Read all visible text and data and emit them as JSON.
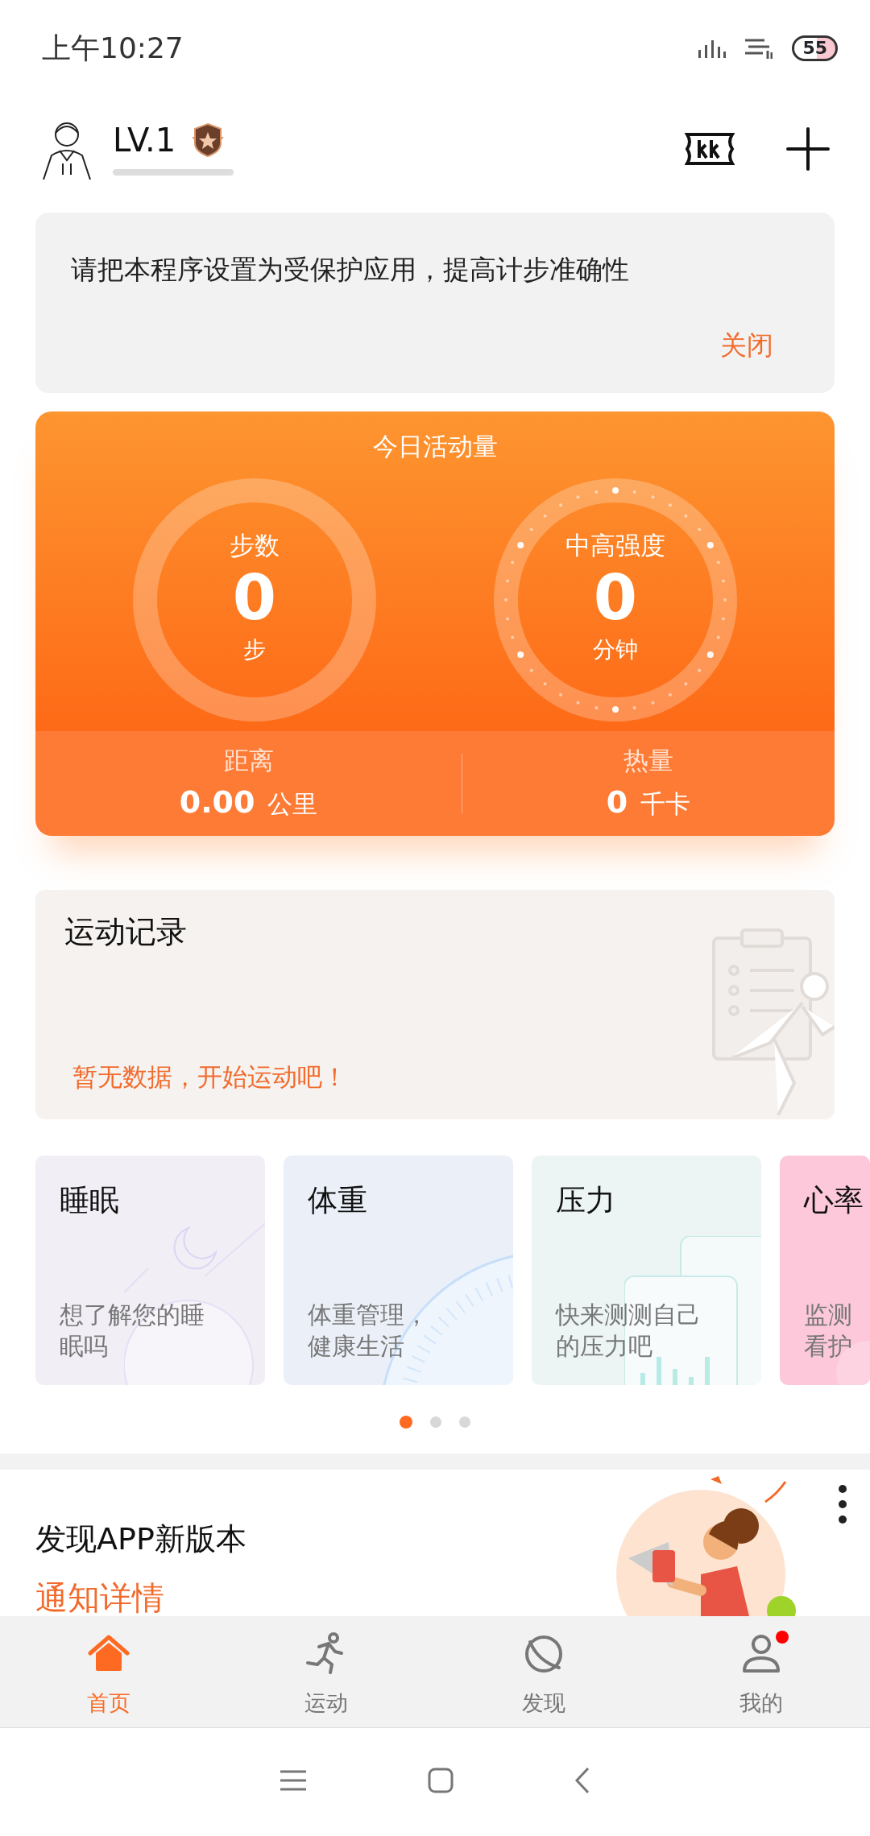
{
  "status_bar": {
    "time": "上午10:27",
    "battery": "55"
  },
  "header": {
    "level_label": "LV.1"
  },
  "notice": {
    "text": "请把本程序设置为受保护应用，提高计步准确性",
    "action": "关闭"
  },
  "activity": {
    "title": "今日活动量",
    "rings": [
      {
        "kind": "plain",
        "label": "步数",
        "value": "0",
        "unit": "步"
      },
      {
        "kind": "dotted",
        "label": "中高强度",
        "value": "0",
        "unit": "分钟"
      }
    ],
    "stats": [
      {
        "label": "距离",
        "value": "0.00",
        "unit": "公里"
      },
      {
        "label": "热量",
        "value": "0",
        "unit": "千卡"
      }
    ]
  },
  "records": {
    "title": "运动记录",
    "empty_text": "暂无数据，开始运动吧！"
  },
  "health_cards": [
    {
      "kind": "sleep",
      "title": "睡眠",
      "desc_lines": [
        "想了解您的睡",
        "眠吗"
      ]
    },
    {
      "kind": "weight",
      "title": "体重",
      "desc_lines": [
        "体重管理，",
        "健康生活"
      ]
    },
    {
      "kind": "stress",
      "title": "压力",
      "desc_lines": [
        "快来测测自己",
        "的压力吧"
      ]
    },
    {
      "kind": "heart",
      "title": "心率",
      "desc_lines": [
        "监测",
        "看护"
      ]
    }
  ],
  "page_dots": [
    {
      "selected": true
    },
    {
      "selected": false
    },
    {
      "selected": false
    }
  ],
  "promo": {
    "title": "发现APP新版本",
    "link": "通知详情"
  },
  "tabs": [
    {
      "kind": "home",
      "label": "首页",
      "selected": true,
      "dot": false
    },
    {
      "kind": "run",
      "label": "运动",
      "selected": false,
      "dot": false
    },
    {
      "kind": "planet",
      "label": "发现",
      "selected": false,
      "dot": false
    },
    {
      "kind": "person",
      "label": "我的",
      "selected": false,
      "dot": true
    }
  ]
}
